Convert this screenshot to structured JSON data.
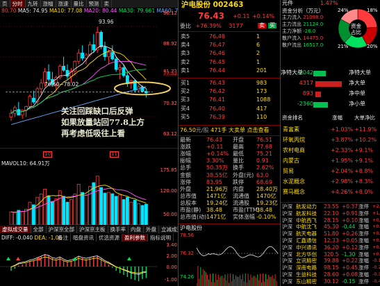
{
  "chart_top": {
    "legend": [
      {
        "text": "80.70",
        "color": "#ff3b3b"
      },
      {
        "text": "MA5: 74.95",
        "color": "#e8e8e8"
      },
      {
        "text": "MA10: 77.08",
        "color": "#ffdd00"
      },
      {
        "text": "MA20: 80.44",
        "color": "#ff55ff"
      },
      {
        "text": "MA30: 79.661",
        "color": "#00e060"
      },
      {
        "text": "MA60: 75.5",
        "color": "#66aaff"
      }
    ],
    "top_tabs": [
      "页",
      "分时",
      "九转",
      "涨幅",
      "涨速",
      "量比",
      "预测",
      "卖"
    ],
    "high_label": "93.96",
    "box_label": "76.60~78.02",
    "price_axis": [
      "96.12",
      "88.92",
      "81.72",
      "77.52",
      "70.32",
      "63.12"
    ],
    "annotation": [
      "关注回踩缺口后反弹",
      "如果放量站回77.8上方",
      "再考虑低吸往上看"
    ]
  },
  "chart_vol": {
    "legend": "MAVOL10: 64.91万",
    "axis": [
      "175.85",
      "120.00",
      "50.00"
    ],
    "bottom_tabs": [
      "虚拟成交量",
      "全部",
      "沪深京全部",
      "沪深京主板",
      "换手率",
      "内盘",
      "外盘",
      "立减成交量"
    ]
  },
  "chart_macd": {
    "legend": [
      {
        "text": "DIFF: -0.040",
        "color": "#e8e8e8"
      },
      {
        "text": "DEA: -1.06",
        "color": "#ffdd00"
      }
    ],
    "tabs": [
      "备注",
      "暗盘资讯",
      "优选资源",
      "盈利参数",
      "指标说明"
    ],
    "axis": [
      "3.40",
      "2.00",
      "0.00",
      "-1.00"
    ]
  },
  "quote": {
    "name": "沪电股份",
    "code": "002463",
    "price": "76.43",
    "change": "+0.11",
    "pct": "+0.14%",
    "weibi_label": "委比",
    "weibi": "+76.39%",
    "weicha": "3177",
    "sells": [
      {
        "lv": "卖",
        "label": "5",
        "price": "76.48",
        "vol": "1"
      },
      {
        "lv": "卖",
        "label": "4",
        "price": "76.47",
        "vol": "6"
      },
      {
        "lv": "卖",
        "label": "3",
        "price": "76.46",
        "vol": "2"
      },
      {
        "lv": "卖",
        "label": "2",
        "price": "76.45",
        "vol": "1"
      },
      {
        "lv": "卖",
        "label": "1",
        "price": "76.44",
        "vol": "201"
      }
    ],
    "buys": [
      {
        "lv": "买",
        "label": "1",
        "price": "76.43",
        "vol": "983"
      },
      {
        "lv": "买",
        "label": "2",
        "price": "76.42",
        "vol": "173"
      },
      {
        "lv": "买",
        "label": "3",
        "price": "76.41",
        "vol": "1088"
      },
      {
        "lv": "买",
        "label": "4",
        "price": "76.40",
        "vol": "417"
      },
      {
        "lv": "买",
        "label": "5",
        "price": "76.39",
        "vol": "110"
      }
    ],
    "last_line": {
      "price": "76.50",
      "tag": "元/股",
      "vol": "471手",
      "tip": "大卖单 点击查看"
    },
    "stats": [
      [
        "最新",
        "76.43",
        "开盘",
        "76.51"
      ],
      [
        "涨跌",
        "+0.11",
        "最高",
        "77.68"
      ],
      [
        "涨幅",
        "+0.14%",
        "最低",
        "75.21"
      ],
      [
        "振幅",
        "3.30%",
        "量比",
        "0.91"
      ],
      [
        "总手",
        "50.35万",
        "换手",
        "2.62%"
      ],
      [
        "金额",
        "38.55亿",
        "外盘(元)",
        "63.0"
      ],
      [
        "涨停",
        "83.95",
        "跌停",
        "68.69"
      ],
      [
        "外盘",
        "21.96万",
        "内盘",
        "28.40万"
      ],
      [
        "总市值",
        "1471亿",
        "流通值",
        "1470亿"
      ],
      [
        "总股本",
        "19.24亿",
        "流通股",
        "19.23亿"
      ],
      [
        "市盈(静)",
        "38.48",
        "市盈(TTM)",
        "38.48"
      ],
      [
        "总市值(动)",
        "1471亿",
        "实体涨幅",
        "-0.10%"
      ]
    ],
    "intraday_title": "沪电股份",
    "intraday_axis": [
      "78.56",
      "76.32",
      "74.26"
    ],
    "intraday_times": [
      "09:30",
      "13:00",
      "15:00"
    ]
  },
  "fund": {
    "header": [
      "元件",
      "1.47%"
    ],
    "subtitle": "资金分析（万元）",
    "flows": [
      {
        "label": "主力流入",
        "value": "21098.0",
        "color": "#ff3b3b"
      },
      {
        "label": "主力流出",
        "value": "21124.0",
        "color": "#00e060"
      },
      {
        "label": "主力净额",
        "value": "-26.0",
        "color": "#00e060"
      },
      {
        "label": "散户流入",
        "value": "14475.0",
        "color": "#ff3b3b"
      },
      {
        "label": "散户流出",
        "value": "16517.0",
        "color": "#00e060"
      }
    ],
    "pie_center": [
      "资金",
      "占比"
    ],
    "pie_pcts": [
      "24%",
      "18%",
      "20%",
      "21%"
    ],
    "pie_slices": [
      24,
      18,
      20,
      21,
      17
    ],
    "net_rows": [
      {
        "label": "净特大单",
        "value": "-2042",
        "amount": -2042
      },
      {
        "label": "净大单",
        "value": "4317",
        "amount": 4317
      },
      {
        "label": "净中单",
        "value": "893",
        "amount": 893
      },
      {
        "label": "净小单",
        "value": "-2360",
        "amount": -2360
      }
    ],
    "sector_header": [
      "资金排名",
      "涨幅",
      "大单净比"
    ],
    "sectors": [
      {
        "name": "青富素",
        "pct": "+1.03%",
        "net": "+11.9%"
      },
      {
        "name": "环氧丙烷",
        "pct": "+3.87%",
        "net": "+10.2%"
      },
      {
        "name": "农村电商",
        "pct": "+2.33%",
        "net": "+9.1%"
      },
      {
        "name": "内蒙古",
        "pct": "+1.95%",
        "net": "+9.1%"
      },
      {
        "name": "贸易",
        "pct": "+2.04%",
        "net": "+8.8%"
      },
      {
        "name": "水泥概念",
        "pct": "+2.98%",
        "net": "+8.3%"
      },
      {
        "name": "赛马概念",
        "pct": "+4.26%",
        "net": "+8.0%"
      }
    ],
    "ticks": [
      {
        "a": "沪深",
        "b": "航发动力",
        "c": "23.55",
        "d": "+0.37",
        "e": "涨停",
        "f": "+2.1"
      },
      {
        "a": "沪深",
        "b": "航发科技",
        "c": "22.10",
        "d": "+0.91",
        "e": "涨停",
        "f": "+1.8"
      },
      {
        "a": "沪深",
        "b": "中航西飞",
        "c": "28.15",
        "d": "+0.10",
        "e": "涨幅",
        "f": "+0.9"
      },
      {
        "a": "沪深",
        "b": "中航沈飞",
        "c": "45.30",
        "d": "-0.44",
        "e": "涨幅",
        "f": "+0.6"
      },
      {
        "a": "沪深",
        "b": "航天电器",
        "c": "51.80",
        "d": "+0.26",
        "e": "涨停",
        "f": "+0.4"
      },
      {
        "a": "沪深",
        "b": "汇鑫通信",
        "c": "12.33",
        "d": "+0.05",
        "e": "涨幅",
        "f": "+0.3"
      },
      {
        "a": "沪深",
        "b": "中兴通讯",
        "c": "36.20",
        "d": "+0.12",
        "e": "涨停",
        "f": "+0.2"
      },
      {
        "a": "沪深",
        "b": "北方华创",
        "c": "320.5",
        "d": "-1.30",
        "e": "涨幅",
        "f": "+0.1"
      },
      {
        "a": "沪深",
        "b": "立讯精密",
        "c": "39.88",
        "d": "+0.22",
        "e": "涨幅",
        "f": "-0.1"
      },
      {
        "a": "沪深",
        "b": "深南电路",
        "c": "98.15",
        "d": "+0.45",
        "e": "涨停",
        "f": "-0.2"
      },
      {
        "a": "沪深",
        "b": "生益科技",
        "c": "28.60",
        "d": "+0.08",
        "e": "涨幅",
        "f": "-0.3"
      },
      {
        "a": "沪深",
        "b": "东山精密",
        "c": "30.12",
        "d": "-0.15",
        "e": "涨停",
        "f": "-0.4"
      }
    ]
  }
}
